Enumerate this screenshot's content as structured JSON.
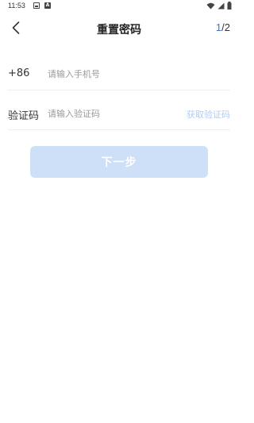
{
  "status_bar": {
    "time": "11:53",
    "icons": [
      "image-icon",
      "a-icon",
      "wifi-icon",
      "signal-icon",
      "battery-icon"
    ]
  },
  "header": {
    "back_icon": "chevron-left-icon",
    "title": "重置密码",
    "step_current": "1",
    "step_total": "/2",
    "step_color": "#3b74d6"
  },
  "form": {
    "phone": {
      "prefix": "+86",
      "placeholder": "请输入手机号",
      "value": ""
    },
    "code": {
      "label": "验证码",
      "placeholder": "请输入验证码",
      "value": "",
      "get_code_label": "获取验证码"
    }
  },
  "next_button": {
    "label": "下一步",
    "color": "#cedff8"
  }
}
